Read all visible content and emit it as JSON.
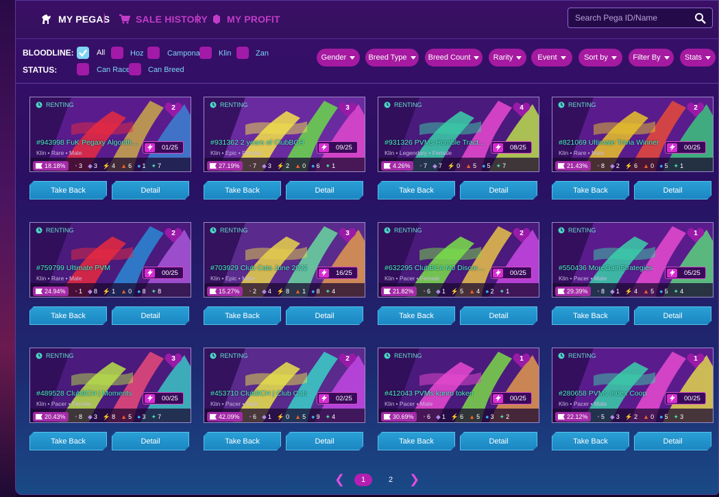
{
  "nav": {
    "tabs": [
      {
        "label": "MY PEGAS",
        "icon": "horse-icon",
        "active": true
      },
      {
        "label": "SALE HISTORY",
        "icon": "cart-icon",
        "active": false
      },
      {
        "label": "MY PROFIT",
        "icon": "coin-icon",
        "active": false
      }
    ],
    "separator": "|"
  },
  "search": {
    "placeholder": "Search Pega ID/Name",
    "icon": "search-icon"
  },
  "filters": {
    "bloodline_label": "BLOODLINE:",
    "bloodlines": [
      {
        "label": "All",
        "checked": true
      },
      {
        "label": "Hoz",
        "checked": false
      },
      {
        "label": "Campona",
        "checked": false
      },
      {
        "label": "Klin",
        "checked": false
      },
      {
        "label": "Zan",
        "checked": false
      }
    ],
    "status_label": "STATUS:",
    "statuses": [
      {
        "label": "Can Race",
        "checked": false
      },
      {
        "label": "Can Breed",
        "checked": false
      }
    ],
    "dropdowns": [
      "Gender",
      "Breed Type",
      "Breed Count",
      "Rarity",
      "Event",
      "Sort by",
      "Filter By",
      "Stats"
    ]
  },
  "card_labels": {
    "renting": "RENTING",
    "take_back": "Take Back",
    "detail": "Detail"
  },
  "colors": {
    "accent": "#a51aa0",
    "button": "#1f8fc9",
    "name": "#4ef0d0",
    "renting": "#64e0cf"
  },
  "cards": [
    {
      "name": "#943998 FuK Pegaxy Algorithms",
      "meta": "Klin • Rare • Male",
      "energy": "01/25",
      "breeds": "2",
      "winrate": "18.18%",
      "stats": [
        "3",
        "3",
        "4",
        "6",
        "1",
        "7"
      ],
      "art": [
        "#5a1c8c",
        "#e82a3f",
        "#c9a84a",
        "#3a8ad6"
      ]
    },
    {
      "name": "#931362 2 years of ClubBCH",
      "meta": "Klin • Epic • Female",
      "energy": "09/25",
      "breeds": "3",
      "winrate": "27.19%",
      "stats": [
        "7",
        "3",
        "2",
        "0",
        "6",
        "1"
      ],
      "art": [
        "#6a2aa0",
        "#f2e24a",
        "#6ad84a",
        "#e84ad0"
      ]
    },
    {
      "name": "#931326 PVMs Humble Tractors Ni...",
      "meta": "Klin • Legendary • Female",
      "energy": "08/25",
      "breeds": "4",
      "winrate": "4.26%",
      "stats": [
        "7",
        "7",
        "0",
        "5",
        "5",
        "7"
      ],
      "art": [
        "#4a1a7c",
        "#3ad0a8",
        "#e84ad0",
        "#c2e84a"
      ]
    },
    {
      "name": "#821069 Ultimate Trivia Winner",
      "meta": "Klin • Rare • Male",
      "energy": "00/25",
      "breeds": "2",
      "winrate": "21.43%",
      "stats": [
        "8",
        "2",
        "6",
        "0",
        "5",
        "1"
      ],
      "art": [
        "#5a1c8c",
        "#e8c22a",
        "#e84a3a",
        "#3ad07a"
      ]
    },
    {
      "name": "#759799 Ultimate PVM",
      "meta": "Klin • Rare • Male",
      "energy": "00/25",
      "breeds": "2",
      "winrate": "24.94%",
      "stats": [
        "1",
        "8",
        "1",
        "0",
        "8",
        "8"
      ],
      "art": [
        "#4a1a7c",
        "#e82a3f",
        "#2a8ad6",
        "#b05ae0"
      ]
    },
    {
      "name": "#703929 Club Cats June 2022",
      "meta": "Klin • Epic • Male",
      "energy": "16/25",
      "breeds": "3",
      "winrate": "15.27%",
      "stats": [
        "2",
        "4",
        "8",
        "1",
        "8",
        "4"
      ],
      "art": [
        "#5a2a8c",
        "#e8d24a",
        "#6ad8a0",
        "#e8a04a"
      ]
    },
    {
      "name": "#632295 ClubBCA MJ Discord Qu...",
      "meta": "Klin • Pacer • Female",
      "energy": "00/25",
      "breeds": "2",
      "winrate": "21.82%",
      "stats": [
        "6",
        "1",
        "5",
        "4",
        "2",
        "1"
      ],
      "art": [
        "#4a1a7c",
        "#7ae04a",
        "#e8c24a",
        "#d04ae8"
      ]
    },
    {
      "name": "#550436 MoreGainStrategies",
      "meta": "Klin • Pacer • Male",
      "energy": "05/25",
      "breeds": "1",
      "winrate": "29.39%",
      "stats": [
        "8",
        "1",
        "4",
        "5",
        "5",
        "4"
      ],
      "art": [
        "#5a1c8c",
        "#3ad0a8",
        "#e84ad0",
        "#5ae07a"
      ]
    },
    {
      "name": "#489528 ClubBCH | Moments",
      "meta": "Klin • Pacer • Female",
      "energy": "00/25",
      "breeds": "3",
      "winrate": "20.43%",
      "stats": [
        "8",
        "3",
        "8",
        "5",
        "3",
        "7"
      ],
      "art": [
        "#4a1a7c",
        "#b8e04a",
        "#e84a7a",
        "#3ad0c8"
      ]
    },
    {
      "name": "#453710 ClubBCH | Club Cats",
      "meta": "Klin • Pacer • Male",
      "energy": "02/25",
      "breeds": "2",
      "winrate": "42.09%",
      "stats": [
        "6",
        "1",
        "0",
        "5",
        "9",
        "4"
      ],
      "art": [
        "#5a2a8c",
        "#e8e24a",
        "#3ad0c8",
        "#c84ae8"
      ]
    },
    {
      "name": "#412043 PVMs konro token",
      "meta": "Klin • Pacer • Male",
      "energy": "00/25",
      "breeds": "1",
      "winrate": "30.69%",
      "stats": [
        "6",
        "1",
        "6",
        "5",
        "3",
        "2"
      ],
      "art": [
        "#4a1a7c",
        "#e84ad0",
        "#7ad84a",
        "#e8a04a"
      ]
    },
    {
      "name": "#280658 PVMs Index Coop",
      "meta": "Klin • Pacer • Male",
      "energy": "00/25",
      "breeds": "1",
      "winrate": "22.12%",
      "stats": [
        "5",
        "3",
        "2",
        "0",
        "5",
        "3"
      ],
      "art": [
        "#5a1c8c",
        "#3ad0a8",
        "#e84ad0",
        "#e8e24a"
      ]
    }
  ],
  "pagination": {
    "pages": [
      "1",
      "2"
    ],
    "current": "1",
    "prev_icon": "chevron-left-icon",
    "next_icon": "chevron-right-icon"
  }
}
